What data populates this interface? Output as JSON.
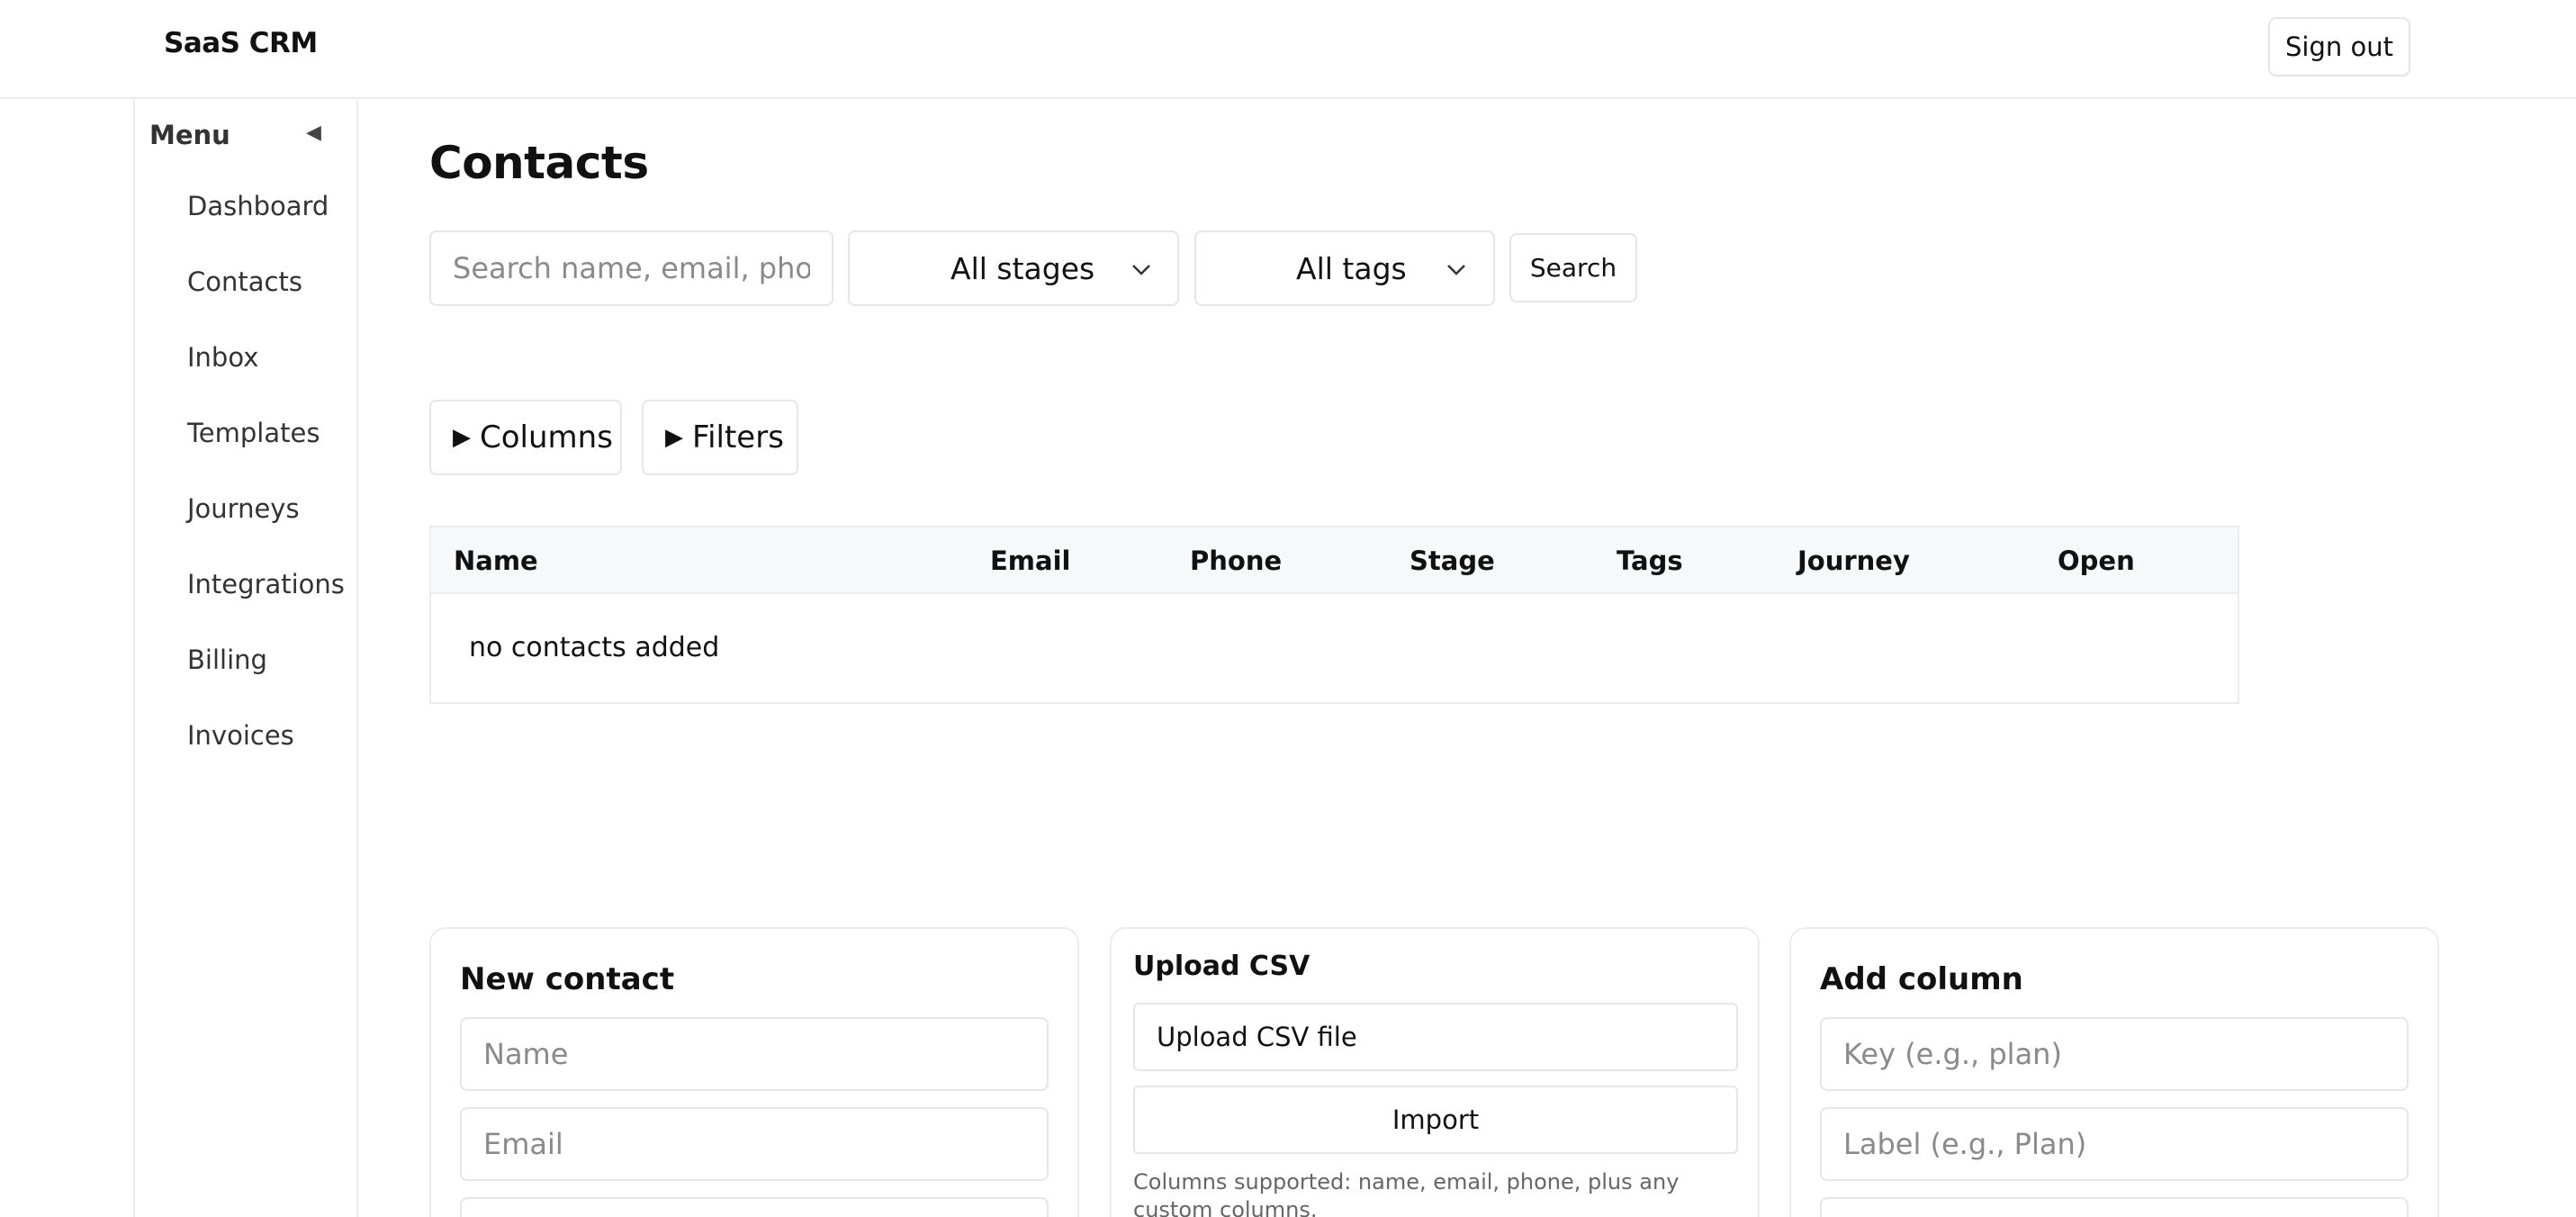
{
  "app": {
    "brand": "SaaS CRM",
    "sign_out_label": "Sign out"
  },
  "sidebar": {
    "title": "Menu",
    "toggle_icon": "collapse-left-icon",
    "items": [
      {
        "label": "Dashboard"
      },
      {
        "label": "Contacts"
      },
      {
        "label": "Inbox"
      },
      {
        "label": "Templates"
      },
      {
        "label": "Journeys"
      },
      {
        "label": "Integrations"
      },
      {
        "label": "Billing"
      },
      {
        "label": "Invoices"
      }
    ]
  },
  "main": {
    "title": "Contacts",
    "search": {
      "placeholder": "Search name, email, phone, etc.",
      "value": ""
    },
    "stage_filter": {
      "selected": "All stages"
    },
    "tag_filter": {
      "selected": "All tags"
    },
    "search_button": "Search",
    "columns_toggle": "Columns",
    "filters_toggle": "Filters",
    "table": {
      "headers": [
        "Name",
        "Email",
        "Phone",
        "Stage",
        "Tags",
        "Journey",
        "Open"
      ],
      "empty_message": "no contacts added"
    }
  },
  "new_contact": {
    "title": "New contact",
    "name_placeholder": "Name",
    "email_placeholder": "Email"
  },
  "upload_csv": {
    "title": "Upload CSV",
    "file_button": "Upload CSV file",
    "import_button": "Import",
    "note": "Columns supported: name, email, phone, plus any custom columns."
  },
  "add_column": {
    "title": "Add column",
    "key_placeholder": "Key (e.g., plan)",
    "label_placeholder": "Label (e.g., Plan)"
  }
}
